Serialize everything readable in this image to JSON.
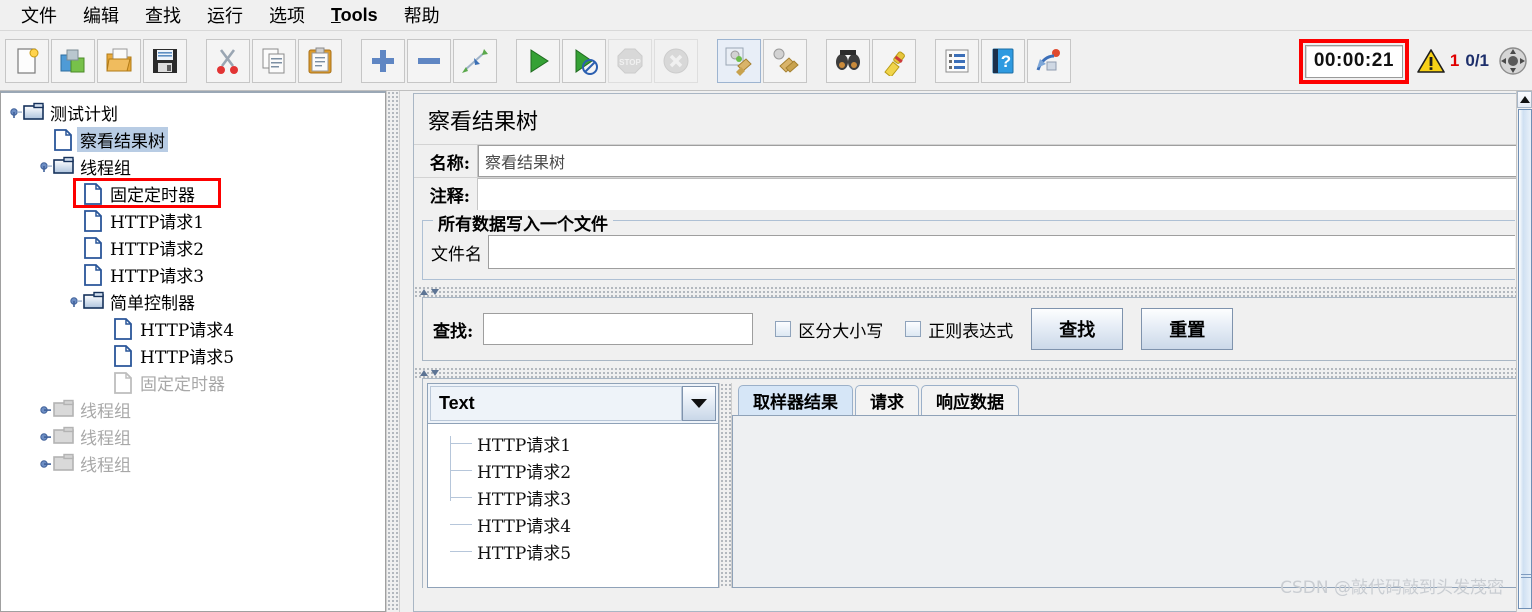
{
  "menu": {
    "items": [
      {
        "label": "文件",
        "mnemonic": false
      },
      {
        "label": "编辑",
        "mnemonic": false
      },
      {
        "label": "查找",
        "mnemonic": false
      },
      {
        "label": "运行",
        "mnemonic": false
      },
      {
        "label": "选项",
        "mnemonic": false
      },
      {
        "label": "Tools",
        "mnemonic": true
      },
      {
        "label": "帮助",
        "mnemonic": false
      }
    ]
  },
  "toolbar": {
    "buttons": [
      {
        "name": "new-icon",
        "title": "新建"
      },
      {
        "name": "templates-icon",
        "title": "模板"
      },
      {
        "name": "open-icon",
        "title": "打开"
      },
      {
        "name": "save-icon",
        "title": "保存"
      },
      {
        "name": "cut-icon",
        "title": "剪切"
      },
      {
        "name": "copy-icon",
        "title": "复制"
      },
      {
        "name": "paste-icon",
        "title": "粘贴"
      },
      {
        "name": "expand-icon",
        "title": "展开"
      },
      {
        "name": "collapse-icon",
        "title": "收起"
      },
      {
        "name": "toggle-icon",
        "title": "启用/禁用"
      },
      {
        "name": "start-icon",
        "title": "启动"
      },
      {
        "name": "start-no-pause-icon",
        "title": "无间隔启动"
      },
      {
        "name": "stop-icon",
        "title": "停止"
      },
      {
        "name": "shutdown-icon",
        "title": "关闭"
      },
      {
        "name": "clear-icon",
        "title": "清除"
      },
      {
        "name": "clear-all-icon",
        "title": "清除全部"
      },
      {
        "name": "search-icon",
        "title": "查找"
      },
      {
        "name": "reset-search-icon",
        "title": "重置查找"
      },
      {
        "name": "function-helper-icon",
        "title": "函数助手"
      },
      {
        "name": "help-icon",
        "title": "帮助"
      },
      {
        "name": "undo-redo-icon",
        "title": "撤销/重做"
      }
    ],
    "timer": "00:00:21",
    "warning_count": "1",
    "thread_count": "0/1",
    "warning_icon": "warning-triangle-icon",
    "remote_icon": "remote-engine-icon"
  },
  "tree": {
    "nodes": [
      {
        "label": "测试计划",
        "icon": "folder-icon",
        "depth": 0,
        "handle": "expanded",
        "state": "normal"
      },
      {
        "label": "察看结果树",
        "icon": "leaf-icon",
        "depth": 1,
        "handle": "none",
        "state": "selected"
      },
      {
        "label": "线程组",
        "icon": "folder-icon",
        "depth": 1,
        "handle": "expanded",
        "state": "normal"
      },
      {
        "label": "固定定时器",
        "icon": "leaf-icon",
        "depth": 2,
        "handle": "none",
        "state": "highlighted-red"
      },
      {
        "label": "HTTP请求1",
        "icon": "leaf-icon",
        "depth": 2,
        "handle": "none",
        "state": "normal"
      },
      {
        "label": "HTTP请求2",
        "icon": "leaf-icon",
        "depth": 2,
        "handle": "none",
        "state": "normal"
      },
      {
        "label": "HTTP请求3",
        "icon": "leaf-icon",
        "depth": 2,
        "handle": "none",
        "state": "normal"
      },
      {
        "label": "简单控制器",
        "icon": "folder-icon",
        "depth": 2,
        "handle": "expanded",
        "state": "normal"
      },
      {
        "label": "HTTP请求4",
        "icon": "leaf-icon",
        "depth": 3,
        "handle": "none",
        "state": "normal"
      },
      {
        "label": "HTTP请求5",
        "icon": "leaf-icon",
        "depth": 3,
        "handle": "none",
        "state": "normal"
      },
      {
        "label": "固定定时器",
        "icon": "leaf-icon",
        "depth": 3,
        "handle": "none",
        "state": "disabled"
      },
      {
        "label": "线程组",
        "icon": "folder-icon",
        "depth": 1,
        "handle": "collapsed",
        "state": "disabled"
      },
      {
        "label": "线程组",
        "icon": "folder-icon",
        "depth": 1,
        "handle": "collapsed",
        "state": "disabled"
      },
      {
        "label": "线程组",
        "icon": "folder-icon",
        "depth": 1,
        "handle": "collapsed",
        "state": "disabled"
      }
    ]
  },
  "panel": {
    "title": "察看结果树",
    "name_label": "名称:",
    "name_value": "察看结果树",
    "comment_label": "注释:",
    "comment_value": "",
    "group_title": "所有数据写入一个文件",
    "filename_label": "文件名",
    "filename_value": ""
  },
  "search": {
    "label": "查找:",
    "value": "",
    "case_sensitive_label": "区分大小写",
    "case_sensitive_checked": false,
    "regex_label": "正则表达式",
    "regex_checked": false,
    "find_button": "查找",
    "reset_button": "重置"
  },
  "results": {
    "renderer_selected": "Text",
    "items": [
      "HTTP请求1",
      "HTTP请求2",
      "HTTP请求3",
      "HTTP请求4",
      "HTTP请求5"
    ],
    "tabs": [
      {
        "label": "取样器结果",
        "active": true
      },
      {
        "label": "请求",
        "active": false
      },
      {
        "label": "响应数据",
        "active": false
      }
    ]
  },
  "watermark": "CSDN @敲代码敲到头发茂密",
  "colors": {
    "selection": "#b8cce4",
    "highlight_box": "#fd0000",
    "warning_text": "#e00000",
    "thread_text": "#1d2f6b",
    "tab_active": "#d6e6f7"
  }
}
